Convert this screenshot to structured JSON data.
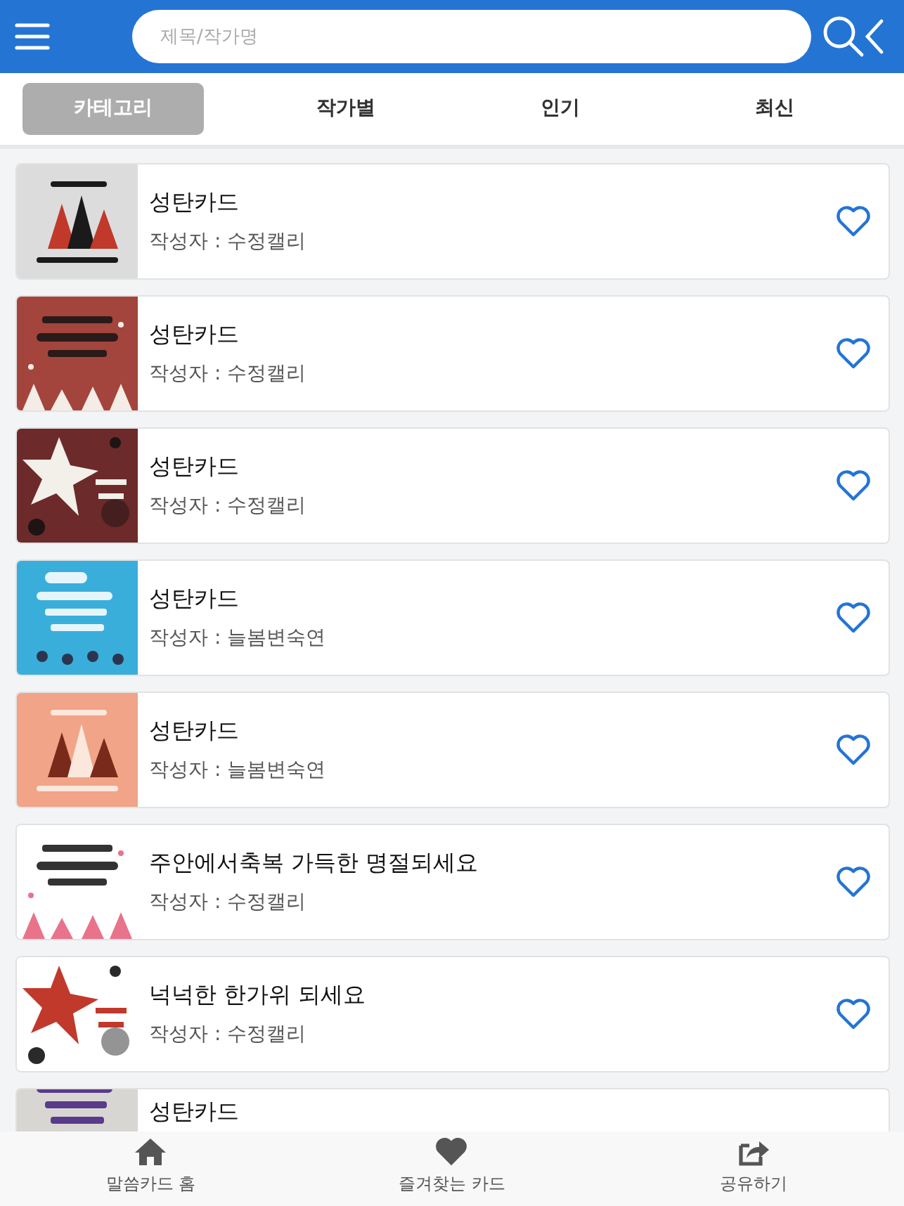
{
  "header": {
    "search": {
      "placeholder": "제목/작가명"
    }
  },
  "tabs": [
    {
      "label": "카테고리",
      "selected": true
    },
    {
      "label": "작가별",
      "selected": false
    },
    {
      "label": "인기",
      "selected": false
    },
    {
      "label": "최신",
      "selected": false
    }
  ],
  "cards": [
    {
      "kind": "picture",
      "title": "성탄카드",
      "author": "작성자 : 수정캘리",
      "favorite": false
    },
    {
      "kind": "picture",
      "title": "성탄카드",
      "author": "작성자 : 수정캘리",
      "favorite": false
    },
    {
      "kind": "picture",
      "title": "성탄카드",
      "author": "작성자 : 수정캘리",
      "favorite": false
    },
    {
      "kind": "picture",
      "title": "성탄카드",
      "author": "작성자 : 늘봄변숙연",
      "favorite": false
    },
    {
      "kind": "picture",
      "title": "성탄카드",
      "author": "작성자 : 늘봄변숙연",
      "favorite": false
    },
    {
      "kind": "picture",
      "title": "주안에서축복 가득한 명절되세요",
      "author": "작성자 : 수정캘리",
      "favorite": false
    },
    {
      "kind": "picture",
      "title": "넉넉한 한가위 되세요",
      "author": "작성자 : 수정캘리",
      "favorite": false
    },
    {
      "kind": "picture",
      "title": "성탄카드"
    }
  ],
  "bottom_nav": [
    {
      "label": "말씀카드 홈"
    },
    {
      "label": "즐겨찾는 카드"
    },
    {
      "label": "공유하기"
    }
  ]
}
